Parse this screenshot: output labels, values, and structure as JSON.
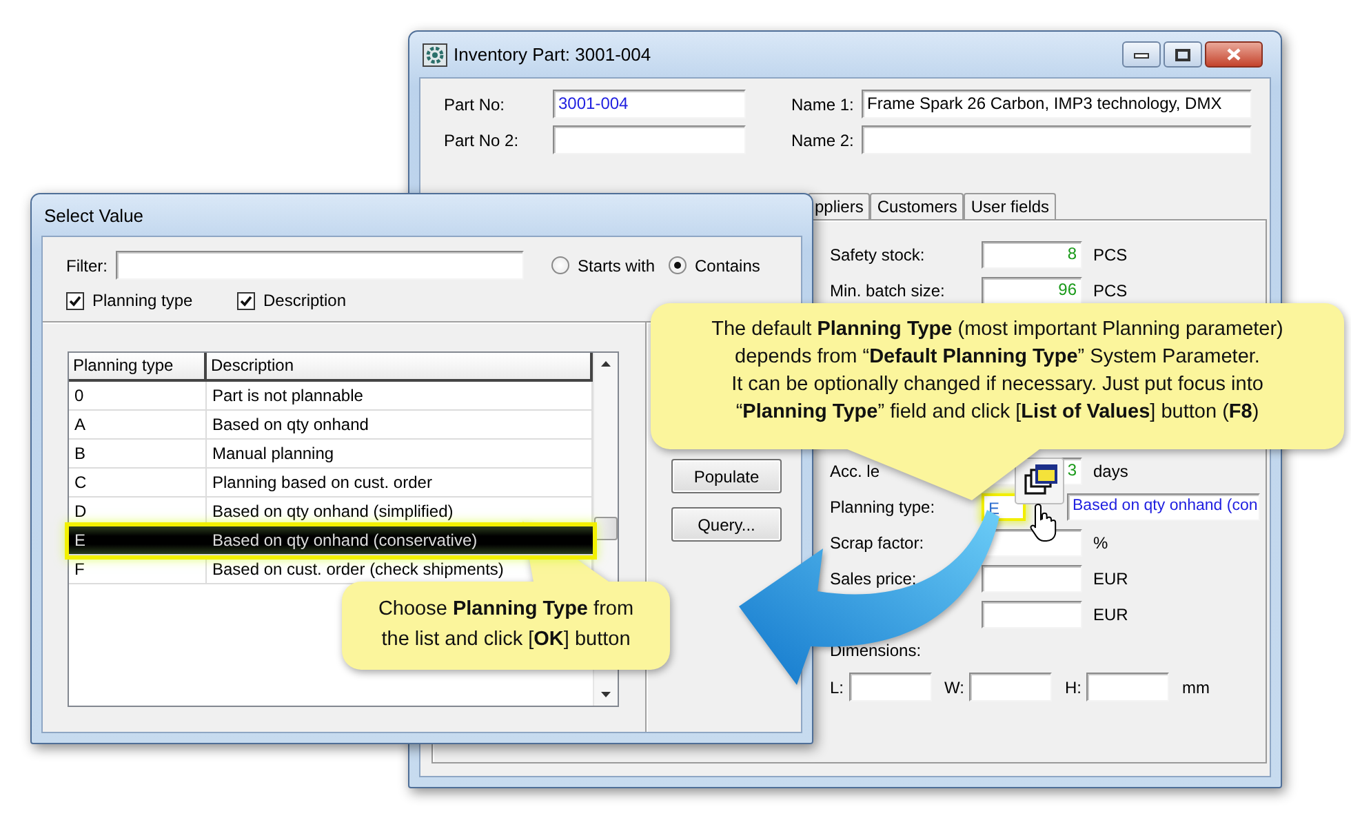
{
  "inventory_window": {
    "title": "Inventory Part: 3001-004",
    "header_fields": [
      {
        "label": "Part No:",
        "value": "3001-004",
        "kind": "key"
      },
      {
        "label": "Name 1:",
        "value": "Frame Spark 26 Carbon, IMP3 technology, DMX",
        "kind": "text"
      },
      {
        "label": "Part No 2:",
        "kind": "text"
      },
      {
        "label": "Name 2:",
        "kind": "text"
      }
    ],
    "tabs": [
      {
        "label": "ppliers",
        "selected": false
      },
      {
        "label": "Customers",
        "selected": false
      },
      {
        "label": "User fields",
        "selected": false
      }
    ],
    "stock_rows": [
      {
        "kind": "number",
        "label": "Safety stock:",
        "value": "8",
        "unit": "PCS"
      },
      {
        "kind": "number",
        "label": "Min. batch size:",
        "value": "96",
        "unit": "PCS"
      }
    ],
    "planning_rows": [
      {
        "kind": "number",
        "label": "Acc. le",
        "value": "3",
        "unit": "days"
      },
      {
        "kind": "lov",
        "label": "Planning type:",
        "value": "E",
        "description": "Based on qty onhand (con",
        "highlighted": true
      },
      {
        "kind": "number",
        "label": "Scrap factor:",
        "unit": "%"
      },
      {
        "kind": "number",
        "label": "Sales price:",
        "unit": "EUR"
      },
      {
        "kind": "number",
        "unit": "EUR"
      }
    ],
    "dimensions": {
      "label": "Dimensions:",
      "fields": [
        {
          "label": "L:"
        },
        {
          "label": "W:"
        },
        {
          "label": "H:"
        }
      ],
      "unit": "mm"
    }
  },
  "select_dialog": {
    "title": "Select Value",
    "filter": {
      "label": "Filter:"
    },
    "match_options": [
      {
        "label": "Starts with",
        "selected": false
      },
      {
        "label": "Contains",
        "selected": true
      }
    ],
    "columns_shown": [
      {
        "label": "Planning type",
        "checked": true
      },
      {
        "label": "Description",
        "checked": true
      }
    ],
    "table": {
      "columns": [
        "Planning type",
        "Description"
      ],
      "rows": [
        {
          "cells": [
            "0",
            "Part is not plannable"
          ],
          "selected": false
        },
        {
          "cells": [
            "A",
            "Based on qty onhand"
          ],
          "selected": false
        },
        {
          "cells": [
            "B",
            "Manual planning"
          ],
          "selected": false
        },
        {
          "cells": [
            "C",
            "Planning based on cust. order"
          ],
          "selected": false
        },
        {
          "cells": [
            "D",
            "Based on qty onhand (simplified)"
          ],
          "selected": false
        },
        {
          "cells": [
            "E",
            "Based on qty onhand (conservative)"
          ],
          "selected": true
        },
        {
          "cells": [
            "F",
            "Based on cust. order (check shipments)"
          ],
          "selected": false
        }
      ]
    },
    "buttons": [
      "Populate",
      "Query..."
    ]
  },
  "callouts": [
    {
      "text": "The default **Planning Type** (most important Planning parameter)\ndepends from “**Default Planning Type**” System Parameter.\nIt can be optionally changed if necessary.  Just put focus into\n“**Planning Type**” field and click [**List of Values**] button (**F8**)"
    },
    {
      "text": "Choose **Planning Type** from\nthe list and click [**OK**] button"
    }
  ]
}
